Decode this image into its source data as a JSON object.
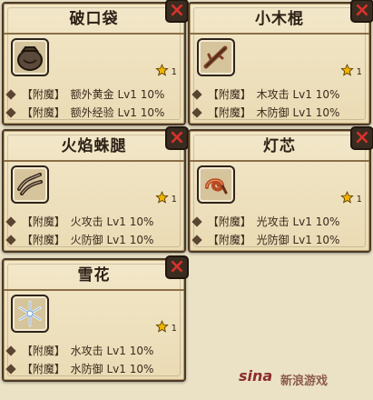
{
  "cards": [
    {
      "title": "破口袋",
      "level": "1",
      "rows": [
        {
          "tag": "【附魔】",
          "desc": "额外黄金 Lv1 10%"
        },
        {
          "tag": "【附魔】",
          "desc": "额外经验 Lv1 10%"
        }
      ],
      "icon": "bag-icon"
    },
    {
      "title": "小木棍",
      "level": "1",
      "rows": [
        {
          "tag": "【附魔】",
          "desc": "木攻击 Lv1 10%"
        },
        {
          "tag": "【附魔】",
          "desc": "木防御 Lv1 10%"
        }
      ],
      "icon": "stick-icon"
    },
    {
      "title": "火焰蛛腿",
      "level": "1",
      "rows": [
        {
          "tag": "【附魔】",
          "desc": "火攻击 Lv1 10%"
        },
        {
          "tag": "【附魔】",
          "desc": "火防御 Lv1 10%"
        }
      ],
      "icon": "spider-leg-icon"
    },
    {
      "title": "灯芯",
      "level": "1",
      "rows": [
        {
          "tag": "【附魔】",
          "desc": "光攻击 Lv1 10%"
        },
        {
          "tag": "【附魔】",
          "desc": "光防御 Lv1 10%"
        }
      ],
      "icon": "wick-icon"
    },
    {
      "title": "雪花",
      "level": "1",
      "rows": [
        {
          "tag": "【附魔】",
          "desc": "水攻击 Lv1 10%"
        },
        {
          "tag": "【附魔】",
          "desc": "水防御 Lv1 10%"
        }
      ],
      "icon": "snowflake-icon"
    }
  ],
  "watermark": {
    "logo": "sina",
    "text": "新浪游戏"
  },
  "colors": {
    "parchment": "#eadbb4",
    "border": "#4b3a2a",
    "close_x": "#d8322c",
    "star": "#f0b400"
  }
}
